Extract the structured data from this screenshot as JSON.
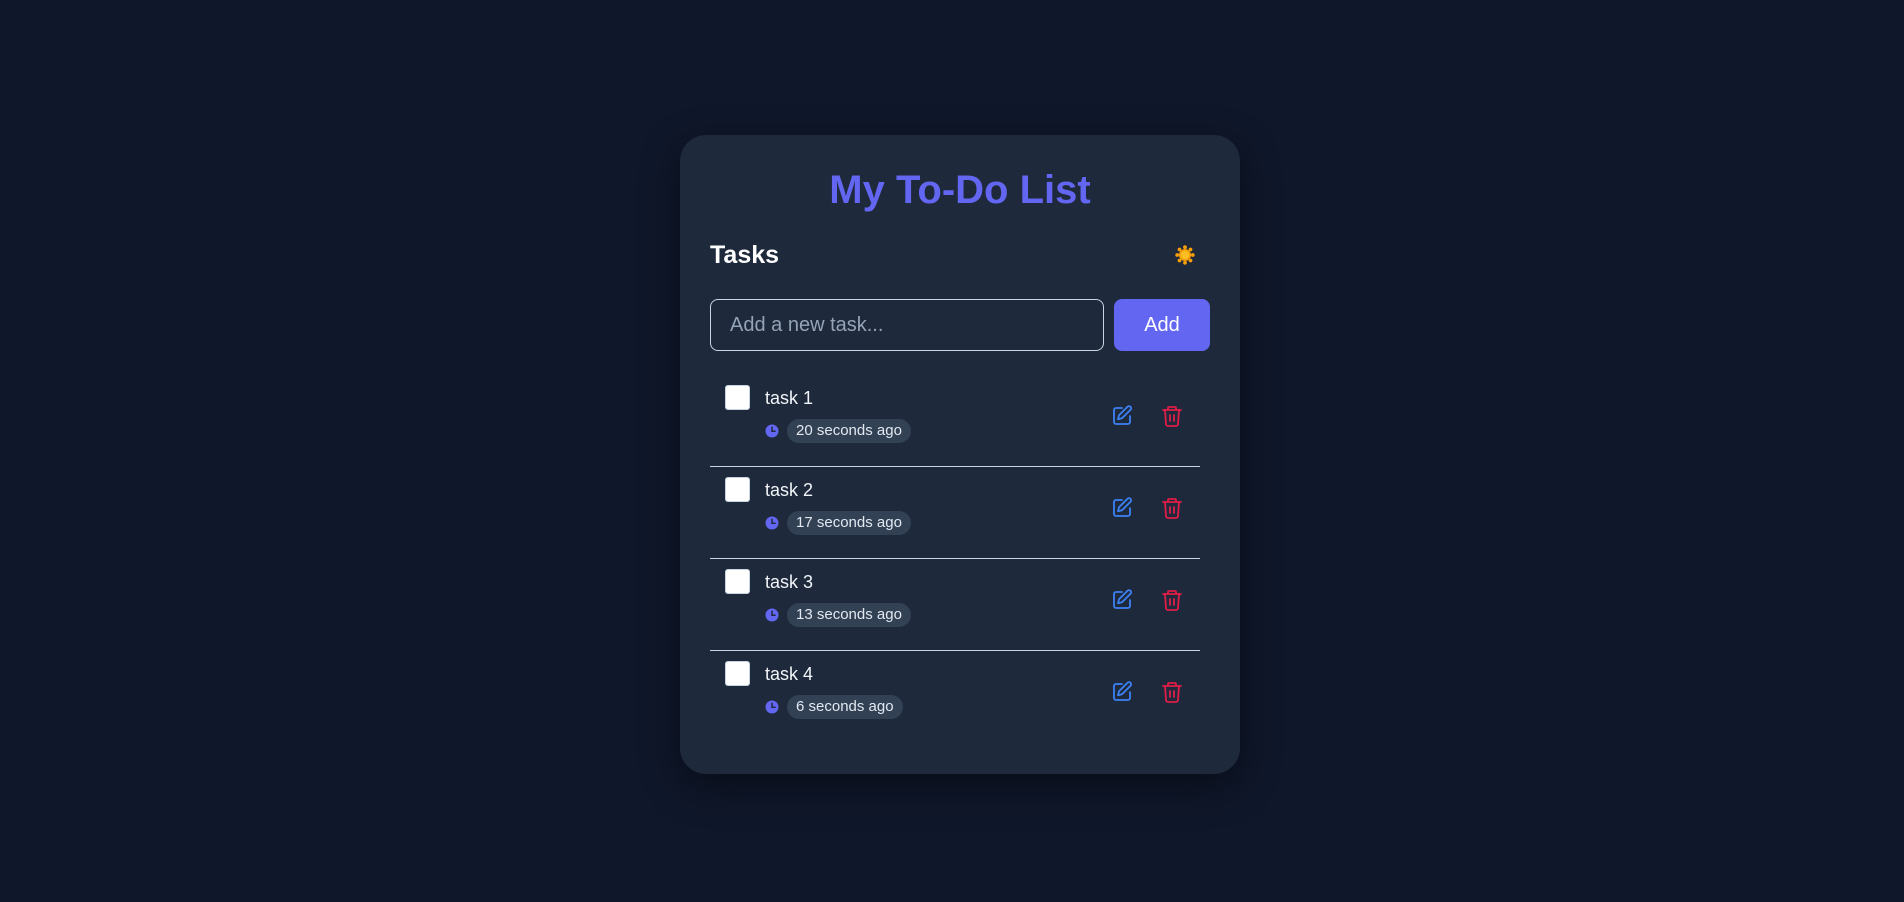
{
  "app": {
    "title": "My To-Do List"
  },
  "tasks_section": {
    "heading": "Tasks",
    "theme_toggle_icon": "sun-icon"
  },
  "add_form": {
    "placeholder": "Add a new task...",
    "value": "",
    "add_label": "Add"
  },
  "tasks": [
    {
      "text": "task 1",
      "time": "20 seconds ago",
      "completed": false
    },
    {
      "text": "task 2",
      "time": "17 seconds ago",
      "completed": false
    },
    {
      "text": "task 3",
      "time": "13 seconds ago",
      "completed": false
    },
    {
      "text": "task 4",
      "time": "6 seconds ago",
      "completed": false
    }
  ],
  "icons": {
    "clock": "clock-icon",
    "edit": "edit-icon",
    "delete": "trash-icon"
  },
  "colors": {
    "background": "#0f172a",
    "card": "#1e293b",
    "accent": "#6366f1",
    "edit": "#3b82f6",
    "delete": "#e11d48",
    "badge": "#334155",
    "sun": "#f59e0b"
  }
}
